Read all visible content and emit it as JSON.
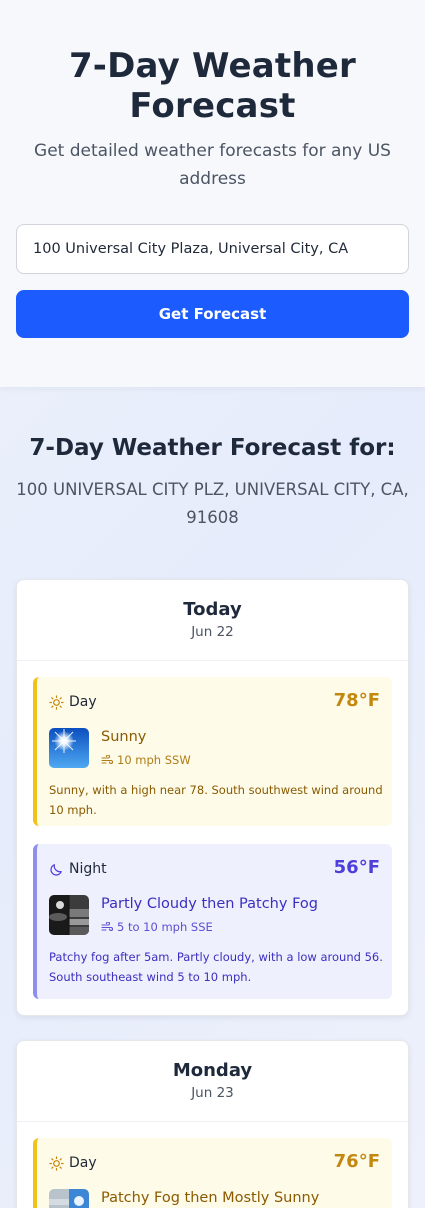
{
  "header": {
    "title": "7-Day Weather Forecast",
    "subtitle": "Get detailed weather forecasts for any US address"
  },
  "search": {
    "value": "100 Universal City Plaza, Universal City, CA",
    "button_label": "Get Forecast"
  },
  "results": {
    "title": "7-Day Weather Forecast for:",
    "address": "100 UNIVERSAL CITY PLZ, UNIVERSAL CITY, CA, 91608"
  },
  "days": [
    {
      "name": "Today",
      "date": "Jun 22",
      "periods": [
        {
          "label": "Day",
          "icon": "sun-icon",
          "temp": "78°F",
          "condition": "Sunny",
          "wind": "10 mph SSW",
          "description": "Sunny, with a high near 78. South southwest wind around 10 mph."
        },
        {
          "label": "Night",
          "icon": "moon-icon",
          "temp": "56°F",
          "condition": "Partly Cloudy then Patchy Fog",
          "wind": "5 to 10 mph SSE",
          "description": "Patchy fog after 5am. Partly cloudy, with a low around 56. South southeast wind 5 to 10 mph."
        }
      ]
    },
    {
      "name": "Monday",
      "date": "Jun 23",
      "periods": [
        {
          "label": "Day",
          "icon": "sun-icon",
          "temp": "76°F",
          "condition": "Patchy Fog then Mostly Sunny"
        }
      ]
    }
  ],
  "colors": {
    "primary_button": "#1c5cff",
    "day_accent": "#f1c21b",
    "night_accent": "#8d8ef0",
    "day_temp": "#c38810",
    "night_temp": "#4f3fd9"
  }
}
